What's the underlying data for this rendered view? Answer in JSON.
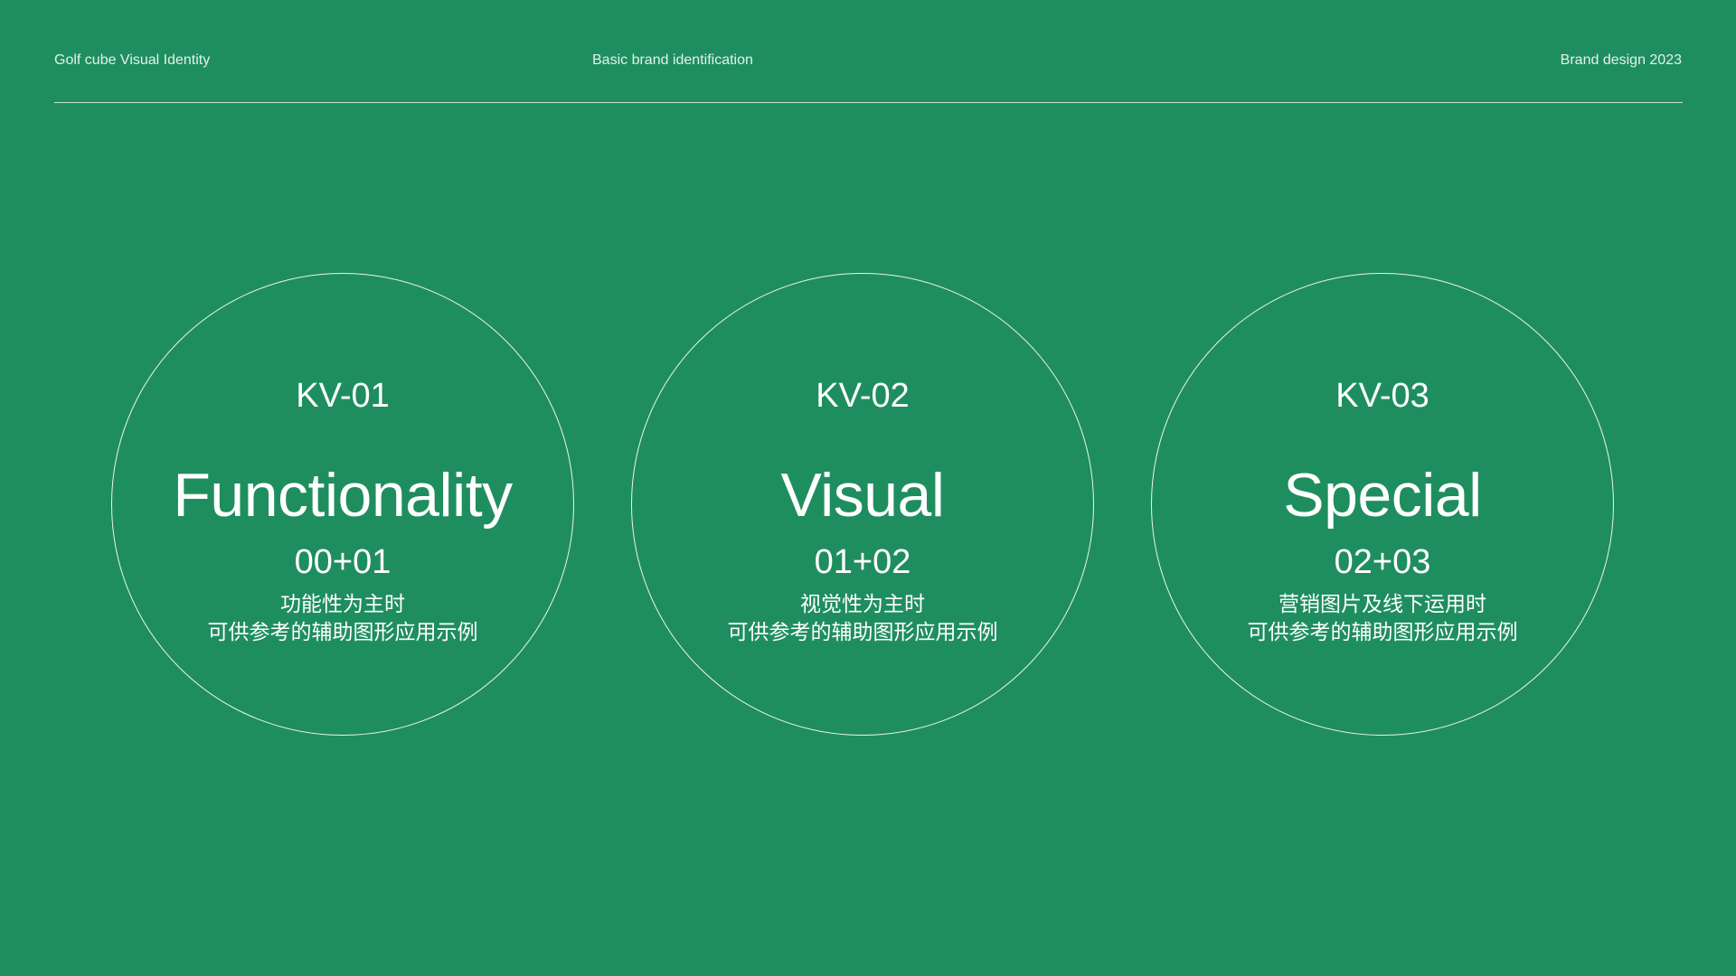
{
  "header": {
    "left": "Golf cube  Visual Identity",
    "center": "Basic brand identification",
    "right": "Brand design 2023"
  },
  "colors": {
    "background": "#1f8e5f",
    "text": "#ffffff"
  },
  "kvs": [
    {
      "label": "KV-01",
      "title": "Functionality",
      "code": "00+01",
      "line1": "功能性为主时",
      "line2": "可供参考的辅助图形应用示例"
    },
    {
      "label": "KV-02",
      "title": "Visual",
      "code": "01+02",
      "line1": "视觉性为主时",
      "line2": "可供参考的辅助图形应用示例"
    },
    {
      "label": "KV-03",
      "title": "Special",
      "code": "02+03",
      "line1": "营销图片及线下运用时",
      "line2": "可供参考的辅助图形应用示例"
    }
  ]
}
